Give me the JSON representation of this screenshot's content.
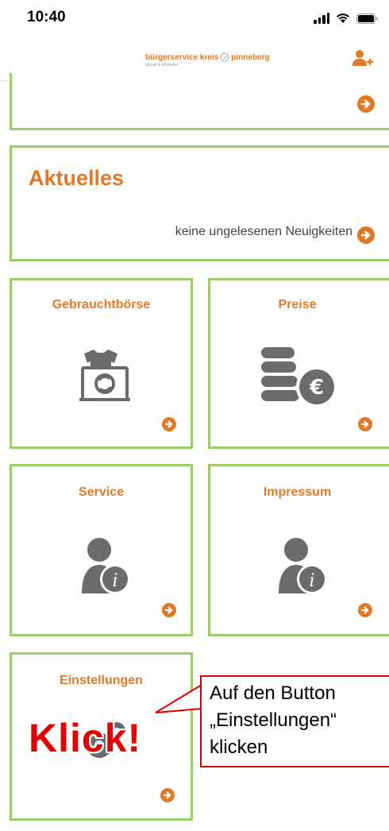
{
  "status_bar": {
    "time": "10:40"
  },
  "header": {
    "logo_text_left": "bürgerservice kreis",
    "logo_text_right": "pinneberg",
    "logo_subtitle": "aktuell & informiert"
  },
  "cards": {
    "aktuelles": {
      "title": "Aktuelles",
      "status": "keine ungelesenen Neuigkeiten"
    },
    "gebrauchtboerse": {
      "title": "Gebrauchtbörse"
    },
    "preise": {
      "title": "Preise"
    },
    "service": {
      "title": "Service"
    },
    "impressum": {
      "title": "Impressum"
    },
    "einstellungen": {
      "title": "Einstellungen"
    }
  },
  "annotation": {
    "klick": "Klick!",
    "callout_text": "Auf den Button\n„Einstellungen“\nklicken"
  },
  "colors": {
    "accent": "#e07a28",
    "border": "#9ccb6b",
    "icon": "#6b6b6b",
    "annotation": "#e30000"
  },
  "icons": [
    "user-add-icon",
    "arrow-circle-right-icon",
    "shirt-monitor-icon",
    "coins-euro-icon",
    "person-info-icon",
    "gears-icon"
  ]
}
